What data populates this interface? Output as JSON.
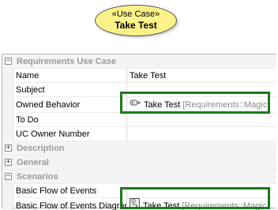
{
  "diagram": {
    "stereotype": "«Use Case»",
    "name": "Take Test",
    "fill_color": "#fbf38a"
  },
  "properties": {
    "highlight_color": "#1b7a1b",
    "categories": [
      {
        "label": "Requirements Use Case",
        "expanded": true,
        "toggle": "−",
        "rows": [
          {
            "name": "Name",
            "value": "Take Test"
          },
          {
            "name": "Subject",
            "value": ""
          },
          {
            "name": "Owned Behavior",
            "value": "Take Test",
            "qualifier": "[Requirements::Magic",
            "icon": "behavior-icon"
          },
          {
            "name": "To Do",
            "value": ""
          },
          {
            "name": "UC Owner Number",
            "value": ""
          }
        ]
      },
      {
        "label": "Description",
        "expanded": false,
        "toggle": "+"
      },
      {
        "label": "General",
        "expanded": false,
        "toggle": "+"
      },
      {
        "label": "Scenarios",
        "expanded": true,
        "toggle": "−",
        "rows": [
          {
            "name": "Basic Flow of Events",
            "value": ""
          },
          {
            "name": "Basic Flow of Events Diagram",
            "value": "Take Test",
            "qualifier": "[Requirements::Magic",
            "icon": "diagram-icon"
          }
        ]
      }
    ]
  }
}
